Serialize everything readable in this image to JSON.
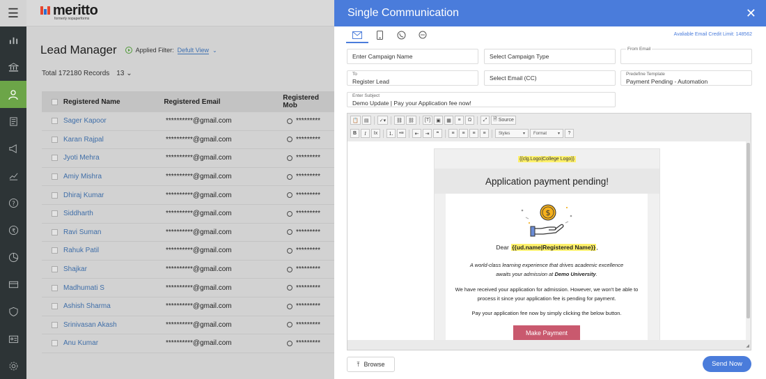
{
  "app": {
    "logo_text": "meritto",
    "logo_subtext": "formerly nopaperforms",
    "menu_icon": "hamburger-icon"
  },
  "sidebar": {
    "items": [
      {
        "icon": "bar-chart-icon"
      },
      {
        "icon": "institution-icon"
      },
      {
        "icon": "user-icon",
        "active": true
      },
      {
        "icon": "document-icon"
      },
      {
        "icon": "megaphone-icon"
      },
      {
        "icon": "analytics-icon"
      },
      {
        "icon": "help-icon"
      },
      {
        "icon": "rupee-icon"
      },
      {
        "icon": "pie-chart-icon"
      },
      {
        "icon": "card-icon"
      },
      {
        "icon": "shield-icon"
      },
      {
        "icon": "id-card-icon"
      },
      {
        "icon": "settings-icon"
      }
    ]
  },
  "page": {
    "title": "Lead Manager",
    "filter_label": "Applied Filter:",
    "filter_value": "Defult View",
    "records_label": "Total 172180 Records",
    "page_size": "13",
    "columns": [
      "Registered Name",
      "Registered Email",
      "Registered Mob"
    ],
    "leads": [
      {
        "name": "Sager Kapoor",
        "email": "**********@gmail.com",
        "mobile": "*********"
      },
      {
        "name": "Karan Rajpal",
        "email": "**********@gmail.com",
        "mobile": "*********"
      },
      {
        "name": "Jyoti Mehra",
        "email": "**********@gmail.com",
        "mobile": "*********"
      },
      {
        "name": "Amiy Mishra",
        "email": "**********@gmail.com",
        "mobile": "*********"
      },
      {
        "name": "Dhiraj Kumar",
        "email": "**********@gmail.com",
        "mobile": "*********"
      },
      {
        "name": "Siddharth",
        "email": "**********@gmail.com",
        "mobile": "*********"
      },
      {
        "name": "Ravi Suman",
        "email": "**********@gmail.com",
        "mobile": "*********"
      },
      {
        "name": "Rahuk Patil",
        "email": "**********@gmail.com",
        "mobile": "*********"
      },
      {
        "name": "Shajkar",
        "email": "**********@gmail.com",
        "mobile": "*********"
      },
      {
        "name": "Madhumati S",
        "email": "**********@gmail.com",
        "mobile": "*********"
      },
      {
        "name": "Ashish Sharma",
        "email": "**********@gmail.com",
        "mobile": "*********"
      },
      {
        "name": "Srinivasan Akash",
        "email": "**********@gmail.com",
        "mobile": "*********"
      },
      {
        "name": "Anu Kumar",
        "email": "**********@gmail.com",
        "mobile": "*********"
      }
    ]
  },
  "modal": {
    "title": "Single Communication",
    "close_icon": "close-icon",
    "channels": [
      "email-icon",
      "mobile-icon",
      "whatsapp-icon",
      "chat-icon"
    ],
    "credit_limit": "Avaliable Email Credit Limit: 148562",
    "campaign_name_placeholder": "Enter Campaign Name",
    "campaign_type_placeholder": "Select Campaign Type",
    "from_email_label": "From Email",
    "from_email_value": "",
    "to_label": "To",
    "to_value": "Register Lead",
    "cc_placeholder": "Select Email (CC)",
    "template_label": "Predefine Template",
    "template_value": "Payment Pending - Automation",
    "subject_label": "Enter Subject",
    "subject_value": "Demo Update | Pay your Application fee now!",
    "toolbar": {
      "source_label": "Source",
      "styles_label": "Styles",
      "format_label": "Format",
      "help_label": "?",
      "bold_label": "B",
      "italic_label": "I"
    },
    "email": {
      "logo_placeholder": "{{clg.Logo|College Logo}}",
      "heading": "Application payment pending!",
      "dear_prefix": "Dear",
      "name_token": "{{ud.name|Registered Name}}",
      "intro_line1": "A world-class learning experience that drives academic excellence",
      "intro_line2_prefix": "awaits your admission at",
      "university": "Demo University",
      "para1": "We have received your application for admission. However, we won't be able to process it since your application fee is pending for payment.",
      "para2": "Pay your application fee now by simply clicking the below button.",
      "button_label": "Make Payment"
    },
    "browse_label": "Browse",
    "send_label": "Send Now"
  },
  "colors": {
    "accent_blue": "#4a7cdb",
    "sidebar_active": "#6ca548",
    "payment_button": "#c9596e",
    "highlight": "#fff16b"
  }
}
